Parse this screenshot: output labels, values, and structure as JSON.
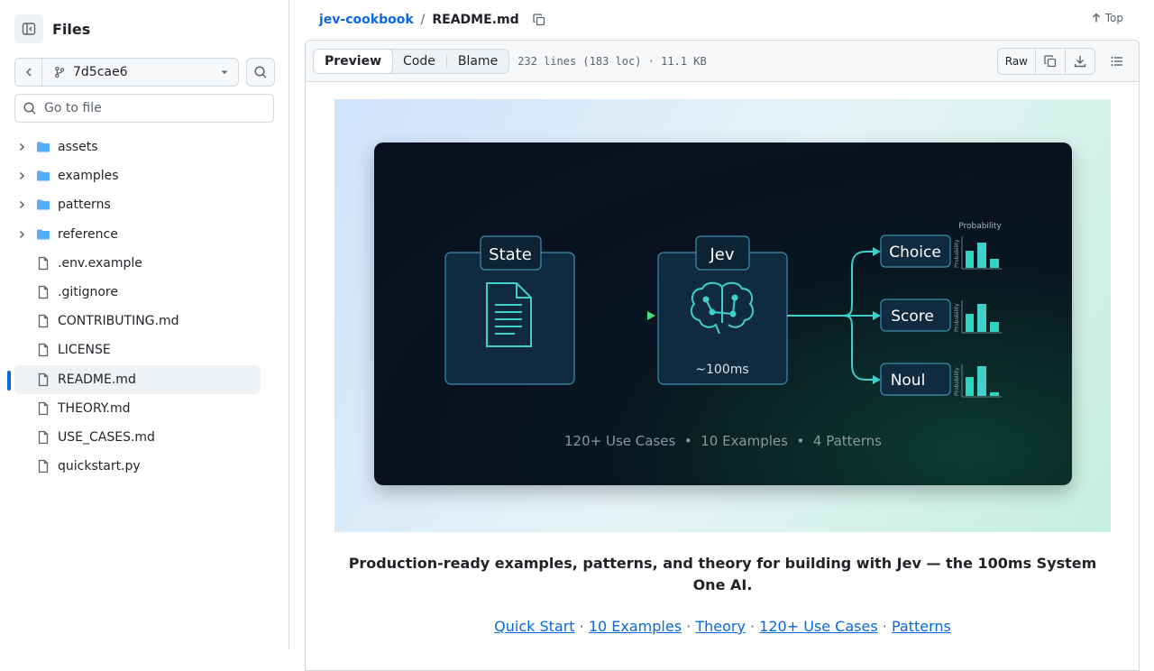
{
  "sidebar": {
    "title": "Files",
    "branch": "7d5cae6",
    "goto_placeholder": "Go to file",
    "tree": [
      {
        "label": "assets",
        "type": "folder"
      },
      {
        "label": "examples",
        "type": "folder"
      },
      {
        "label": "patterns",
        "type": "folder"
      },
      {
        "label": "reference",
        "type": "folder"
      },
      {
        "label": ".env.example",
        "type": "file"
      },
      {
        "label": ".gitignore",
        "type": "file"
      },
      {
        "label": "CONTRIBUTING.md",
        "type": "file"
      },
      {
        "label": "LICENSE",
        "type": "file"
      },
      {
        "label": "README.md",
        "type": "file",
        "active": true
      },
      {
        "label": "THEORY.md",
        "type": "file"
      },
      {
        "label": "USE_CASES.md",
        "type": "file"
      },
      {
        "label": "quickstart.py",
        "type": "file"
      }
    ]
  },
  "breadcrumb": {
    "repo": "jev-cookbook",
    "sep": "/",
    "file": "README.md"
  },
  "top_link": "Top",
  "file_header": {
    "tabs": [
      "Preview",
      "Code",
      "Blame"
    ],
    "selected_tab": "Preview",
    "meta": "232 lines (183 loc) · 11.1 KB",
    "raw": "Raw"
  },
  "banner": {
    "state_label": "State",
    "jev_label": "Jev",
    "latency": "~100ms",
    "outputs": [
      "Choice",
      "Score",
      "Noul"
    ],
    "prob_header": "Probability",
    "prob_axis": "Probability",
    "footer": "120+ Use Cases  •  10 Examples  •  4 Patterns"
  },
  "readme": {
    "tagline": "Production-ready examples, patterns, and theory for building with Jev — the 100ms System One AI.",
    "links": [
      "Quick Start",
      "10 Examples",
      "Theory",
      "120+ Use Cases",
      "Patterns"
    ],
    "link_sep": " · "
  },
  "colors": {
    "accent": "#0969da",
    "border": "#d1d9e0",
    "teal": "#3fd0c9",
    "green": "#4ade80"
  }
}
